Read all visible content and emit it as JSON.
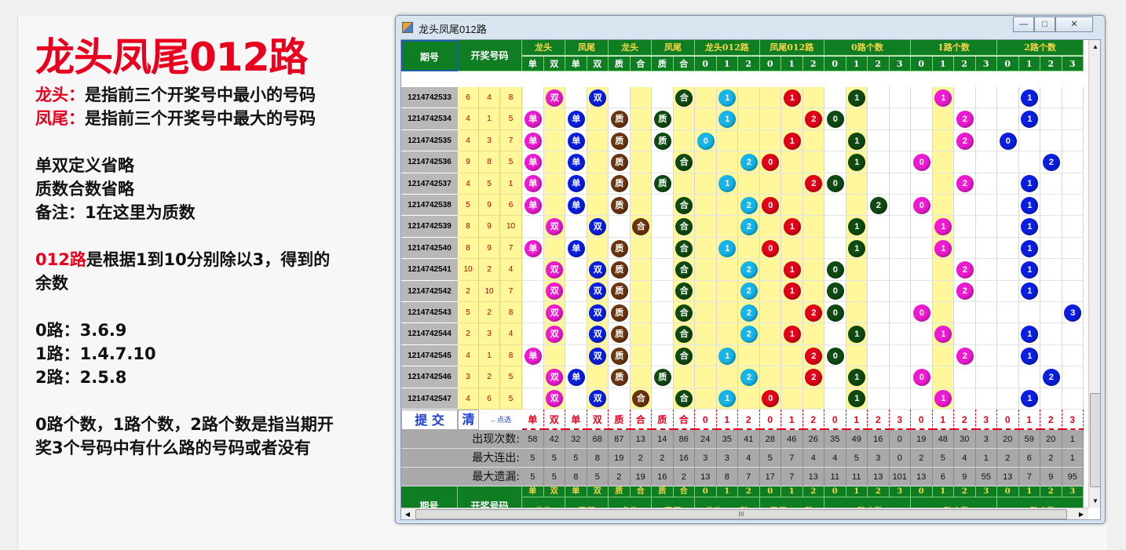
{
  "explanation": {
    "title": "龙头凤尾012路",
    "longtou_key": "龙头：",
    "longtou_text": "是指前三个开奖号中最小的号码",
    "fengwei_key": "凤尾：",
    "fengwei_text": "是指前三个开奖号中最大的号码",
    "note1": "单双定义省略",
    "note2": "质数合数省略",
    "note3": "备注：1在这里为质数",
    "road_key": "012路",
    "road_text": "是根据1到10分别除以3，得到的",
    "road_text2": "余数",
    "road0": "0路：3.6.9",
    "road1": "1路：1.4.7.10",
    "road2": "2路：2.5.8",
    "count_text": "0路个数，1路个数，2路个数是指当期开",
    "count_text2": "奖3个号码中有什么路的号码或者没有"
  },
  "window": {
    "title": "龙头凤尾012路",
    "min_icon": "minimize-icon",
    "max_icon": "maximize-icon",
    "close_icon": "close-icon"
  },
  "colors": {
    "header_green": "#0f7d22",
    "header_text": "#f5d74a",
    "pink": "#ee1ad2",
    "blue": "#0a1ee0",
    "brown": "#6b3510",
    "dark_green": "#0e4a12",
    "red": "#e0001a",
    "cyan": "#16b4e8",
    "yellow": "#fff799"
  },
  "table": {
    "col_period": "期号",
    "col_numbers": "开奖号码",
    "groups": [
      "龙头",
      "凤尾",
      "龙头",
      "凤尾",
      "龙头012路",
      "凤尾012路",
      "0路个数",
      "1路个数",
      "2路个数"
    ],
    "subs": [
      "单",
      "双",
      "单",
      "双",
      "质",
      "合",
      "质",
      "合",
      "0",
      "1",
      "2",
      "0",
      "1",
      "2",
      "0",
      "1",
      "2",
      "3",
      "0",
      "1",
      "2",
      "3",
      "0",
      "1",
      "2",
      "3"
    ],
    "rows": [
      {
        "p": "1214742533",
        "n": [
          "6",
          "4",
          "8"
        ],
        "sel": [
          1,
          1,
          3,
          1,
          1,
          1,
          1,
          1,
          1
        ]
      },
      {
        "p": "1214742534",
        "n": [
          "4",
          "1",
          "5"
        ],
        "sel": [
          0,
          0,
          0,
          0,
          1,
          2,
          0,
          2,
          1
        ]
      },
      {
        "p": "1214742535",
        "n": [
          "4",
          "3",
          "7"
        ],
        "sel": [
          0,
          0,
          0,
          0,
          0,
          1,
          1,
          2,
          0
        ]
      },
      {
        "p": "1214742536",
        "n": [
          "9",
          "8",
          "5"
        ],
        "sel": [
          0,
          0,
          0,
          1,
          2,
          0,
          1,
          0,
          2
        ]
      },
      {
        "p": "1214742537",
        "n": [
          "4",
          "5",
          "1"
        ],
        "sel": [
          0,
          0,
          0,
          0,
          1,
          2,
          0,
          2,
          1
        ]
      },
      {
        "p": "1214742538",
        "n": [
          "5",
          "9",
          "6"
        ],
        "sel": [
          0,
          0,
          0,
          1,
          2,
          0,
          2,
          0,
          1
        ]
      },
      {
        "p": "1214742539",
        "n": [
          "8",
          "9",
          "10"
        ],
        "sel": [
          1,
          1,
          1,
          1,
          2,
          1,
          1,
          1,
          1
        ]
      },
      {
        "p": "1214742540",
        "n": [
          "8",
          "9",
          "7"
        ],
        "sel": [
          0,
          0,
          0,
          1,
          1,
          0,
          1,
          1,
          1
        ]
      },
      {
        "p": "1214742541",
        "n": [
          "10",
          "2",
          "4"
        ],
        "sel": [
          1,
          1,
          0,
          1,
          2,
          1,
          0,
          2,
          1
        ]
      },
      {
        "p": "1214742542",
        "n": [
          "2",
          "10",
          "7"
        ],
        "sel": [
          1,
          1,
          0,
          1,
          2,
          1,
          0,
          2,
          1
        ]
      },
      {
        "p": "1214742543",
        "n": [
          "5",
          "2",
          "8"
        ],
        "sel": [
          1,
          1,
          0,
          1,
          2,
          2,
          0,
          0,
          3
        ]
      },
      {
        "p": "1214742544",
        "n": [
          "2",
          "3",
          "4"
        ],
        "sel": [
          1,
          1,
          0,
          1,
          2,
          1,
          1,
          1,
          1
        ]
      },
      {
        "p": "1214742545",
        "n": [
          "4",
          "1",
          "8"
        ],
        "sel": [
          0,
          1,
          0,
          1,
          1,
          2,
          0,
          2,
          1
        ]
      },
      {
        "p": "1214742546",
        "n": [
          "3",
          "2",
          "5"
        ],
        "sel": [
          1,
          0,
          0,
          0,
          2,
          2,
          1,
          0,
          2
        ]
      },
      {
        "p": "1214742547",
        "n": [
          "4",
          "6",
          "5"
        ],
        "sel": [
          1,
          1,
          1,
          1,
          1,
          0,
          1,
          1,
          1
        ]
      }
    ],
    "submit": "提 交",
    "clear": "清",
    "select_hint": "←点选",
    "stat_labels": [
      "出现次数:",
      "最大连出:",
      "最大遗漏:"
    ],
    "stats": [
      [
        "58",
        "42",
        "32",
        "68",
        "87",
        "13",
        "14",
        "86",
        "24",
        "35",
        "41",
        "28",
        "46",
        "26",
        "35",
        "49",
        "16",
        "0",
        "19",
        "48",
        "30",
        "3",
        "20",
        "59",
        "20",
        "1"
      ],
      [
        "5",
        "5",
        "5",
        "8",
        "19",
        "2",
        "2",
        "16",
        "3",
        "3",
        "4",
        "5",
        "7",
        "4",
        "4",
        "5",
        "3",
        "0",
        "2",
        "5",
        "4",
        "1",
        "2",
        "6",
        "2",
        "1"
      ],
      [
        "5",
        "5",
        "8",
        "5",
        "2",
        "19",
        "16",
        "2",
        "13",
        "8",
        "7",
        "17",
        "7",
        "13",
        "11",
        "11",
        "13",
        "101",
        "13",
        "6",
        "9",
        "55",
        "13",
        "7",
        "9",
        "95"
      ]
    ]
  },
  "scrollbar": {
    "grip": "III"
  }
}
